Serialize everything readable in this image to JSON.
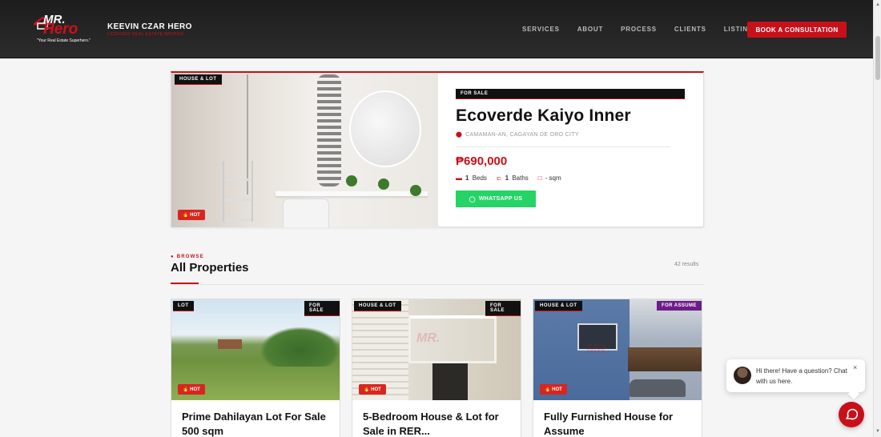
{
  "header": {
    "logo_mr": "MR.",
    "logo_hero": "Hero",
    "logo_tagline": "\"Your Real Estate Superhero.\"",
    "brand_name": "KEEVIN CZAR HERO",
    "brand_sub": "LICENSED REAL ESTATE BROKER",
    "nav": [
      "SERVICES",
      "ABOUT",
      "PROCESS",
      "CLIENTS",
      "LISTING"
    ],
    "cta_label": "BOOK A CONSULTATION"
  },
  "featured": {
    "category": "HOUSE & LOT",
    "hot_label": "🔥 HOT",
    "status": "FOR SALE",
    "title": "Ecoverde Kaiyo Inner",
    "location": "CAMAMAN-AN, CAGAYAN DE ORO CITY",
    "price": "₱690,000",
    "beds_count": "1",
    "beds_label": "Beds",
    "baths_count": "1",
    "baths_label": "Baths",
    "area_count": "-",
    "area_label": "sqm",
    "whatsapp_label": "WHATSAPP US"
  },
  "section": {
    "eyebrow": "● BROWSE",
    "title": "All Properties",
    "results": "42 results"
  },
  "listings": [
    {
      "category": "LOT",
      "status": "FOR SALE",
      "hot": "🔥 HOT",
      "title": "Prime Dahilayan Lot For Sale 500 sqm"
    },
    {
      "category": "HOUSE & LOT",
      "status": "FOR SALE",
      "hot": "🔥 HOT",
      "title": "5-Bedroom House & Lot for Sale in RER..."
    },
    {
      "category": "HOUSE & LOT",
      "status": "FOR ASSUME",
      "hot": "🔥 HOT",
      "title": "Fully Furnished House for Assume"
    }
  ],
  "chat": {
    "message": "Hi there! Have a question? Chat with us here.",
    "close": "×"
  },
  "colors": {
    "accent": "#c8101a",
    "whatsapp": "#25d366",
    "header_bg": "#242424",
    "assume_badge": "#6d1c8a"
  }
}
